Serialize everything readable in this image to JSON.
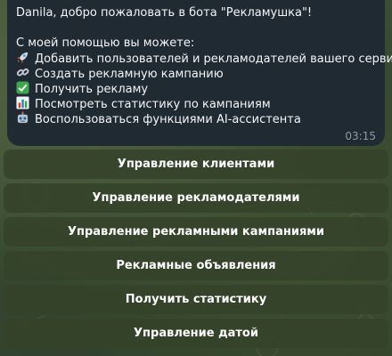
{
  "message": {
    "greeting": "Danila, добро пожаловать в бота \"Рекламушка\"!",
    "intro": "С моей помощью вы можете:",
    "items": [
      {
        "icon": "rocket-icon",
        "text": "Добавить пользователей и рекламодателей вашего сервиса"
      },
      {
        "icon": "link-icon",
        "text": "Создать рекламную кампанию"
      },
      {
        "icon": "check-icon",
        "text": "Получить рекламу"
      },
      {
        "icon": "chart-icon",
        "text": "Посмотреть статистику по кампаниям"
      },
      {
        "icon": "robot-icon",
        "text": "Воспользоваться функциями AI-ассистента"
      }
    ],
    "time": "03:15"
  },
  "keyboard": {
    "buttons": [
      {
        "label": "Управление клиентами"
      },
      {
        "label": "Управление рекламодателями"
      },
      {
        "label": "Управление рекламными кампаниями"
      },
      {
        "label": "Рекламные объявления"
      },
      {
        "label": "Получить статистику"
      },
      {
        "label": "Управление датой"
      }
    ]
  },
  "colors": {
    "bubble": "#202a33",
    "button": "#34422a",
    "background": "#3a4a2c"
  }
}
